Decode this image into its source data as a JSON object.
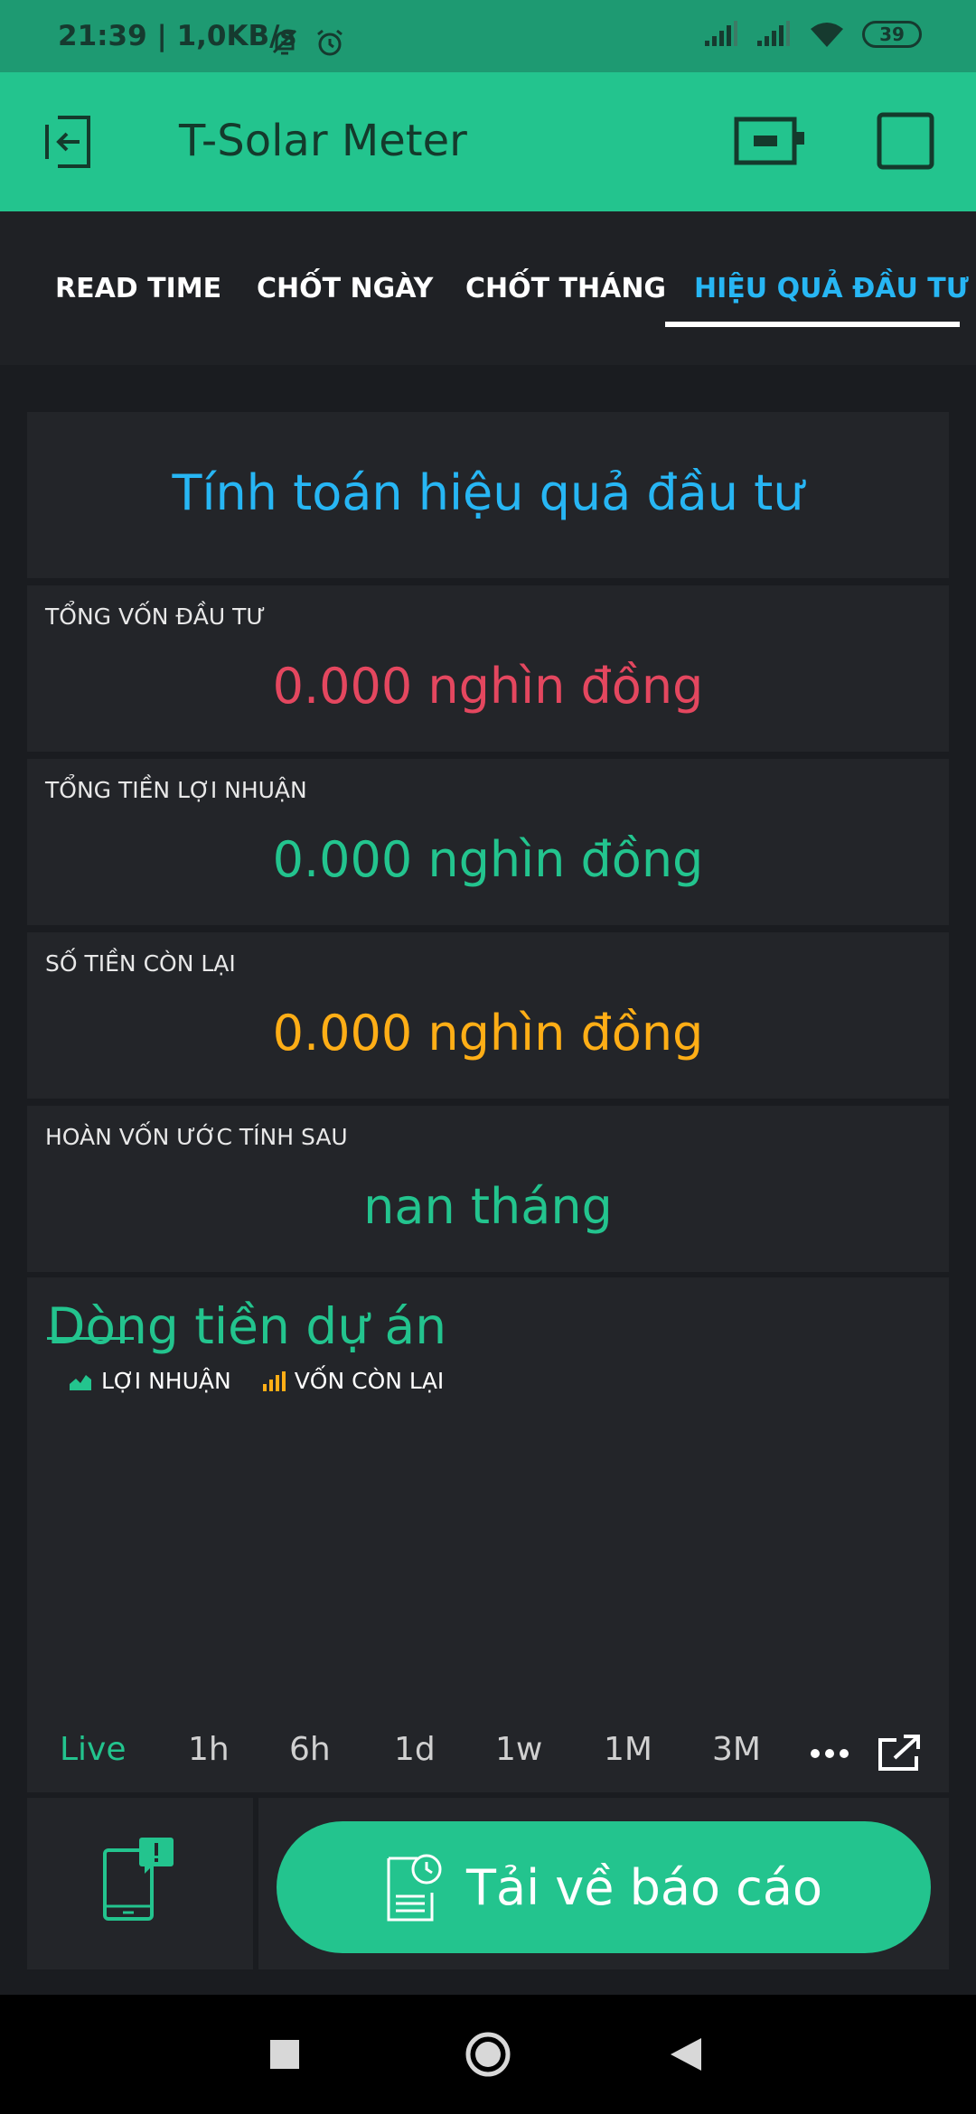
{
  "status_bar": {
    "time": "21:39 | 1,0KB/s",
    "battery": "39"
  },
  "app_bar": {
    "title": "T-Solar Meter"
  },
  "tabs": [
    {
      "label": "READ TIME"
    },
    {
      "label": "CHỐT NGÀY"
    },
    {
      "label": "CHỐT THÁNG"
    },
    {
      "label": "HIỆU QUẢ ĐẦU TƯ"
    }
  ],
  "content": {
    "title": "Tính toán hiệu quả đầu tư",
    "cards": [
      {
        "label": "TỔNG VỐN ĐẦU TƯ",
        "value": "0.000 nghìn đồng",
        "color": "#e4475f"
      },
      {
        "label": "TỔNG TIỀN LỢI NHUẬN",
        "value": "0.000 nghìn đồng",
        "color": "#23c48e"
      },
      {
        "label": "SỐ TIỀN CÒN LẠI",
        "value": "0.000 nghìn đồng",
        "color": "#ffae16"
      },
      {
        "label": "HOÀN VỐN ƯỚC TÍNH SAU",
        "value": "nan tháng",
        "color": "#23c48e"
      }
    ]
  },
  "chart": {
    "title": "Dòng tiền dự án",
    "legend": [
      {
        "label": "LỢI NHUẬN",
        "color": "#23c48e",
        "icon": "area-chart-icon"
      },
      {
        "label": "VỐN CÒN LẠI",
        "color": "#ffae16",
        "icon": "bar-chart-icon"
      }
    ],
    "ranges": [
      "Live",
      "1h",
      "6h",
      "1d",
      "1w",
      "1M",
      "3M"
    ],
    "selected_range": "Live"
  },
  "download_button": {
    "label": "Tải về báo cáo"
  },
  "colors": {
    "accent": "#23c48e",
    "blue": "#27b6f4",
    "background": "#1a1c20"
  }
}
